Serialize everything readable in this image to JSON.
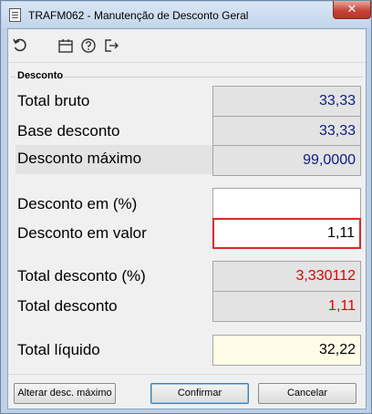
{
  "window": {
    "title": "TRAFM062 - Manutenção de Desconto Geral",
    "close_glyph": "✕"
  },
  "toolbar": {
    "icons": [
      "undo-icon",
      "calendar-icon",
      "help-icon",
      "exit-icon"
    ]
  },
  "group": {
    "label": "Desconto"
  },
  "rows": {
    "total_bruto": {
      "label": "Total bruto",
      "value": "33,33"
    },
    "base_desconto": {
      "label": "Base desconto",
      "value": "33,33"
    },
    "desconto_maximo": {
      "label": "Desconto máximo",
      "value": "99,0000"
    },
    "desconto_pct": {
      "label": "Desconto em (%)",
      "value": ""
    },
    "desconto_valor": {
      "label": "Desconto em valor",
      "value": "1,11"
    },
    "total_desconto_pct": {
      "label": "Total desconto (%)",
      "value": "3,330112"
    },
    "total_desconto": {
      "label": "Total desconto",
      "value": "1,11"
    },
    "total_liquido": {
      "label": "Total líquido",
      "value": "32,22"
    }
  },
  "buttons": {
    "alterar": "Alterar desc. máximo",
    "confirmar": "Confirmar",
    "cancelar": "Cancelar"
  },
  "colors": {
    "value_blue": "#0c1b8a",
    "value_red": "#e00000",
    "focus_border": "#d52b2b",
    "total_bg": "#fffde8"
  }
}
